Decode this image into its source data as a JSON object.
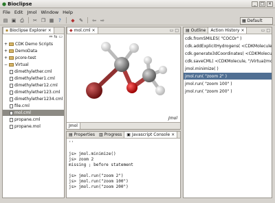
{
  "window": {
    "title": "Bioclipse"
  },
  "menu": [
    "File",
    "Edit",
    "Jmol",
    "Window",
    "Help"
  ],
  "perspective": {
    "label": "Default"
  },
  "explorer": {
    "tab_label": "Bioclipse Explorer",
    "items": [
      {
        "label": "CDK Demo Scripts",
        "kind": "folder",
        "indent": 0,
        "expander": "+"
      },
      {
        "label": "DemoData",
        "kind": "folder",
        "indent": 0,
        "expander": "+"
      },
      {
        "label": "pcore-test",
        "kind": "folder",
        "indent": 0,
        "expander": "+"
      },
      {
        "label": "Virtual",
        "kind": "folder",
        "indent": 0,
        "expander": "−"
      },
      {
        "label": "dimethylether.cml",
        "kind": "file",
        "indent": 1
      },
      {
        "label": "dimethylether1.cml",
        "kind": "file",
        "indent": 1
      },
      {
        "label": "dimethylether12.cml",
        "kind": "file",
        "indent": 1
      },
      {
        "label": "dimethylether123.cml",
        "kind": "file",
        "indent": 1
      },
      {
        "label": "dimethylether1234.cml",
        "kind": "file",
        "indent": 1
      },
      {
        "label": "file.cml",
        "kind": "file",
        "indent": 1
      },
      {
        "label": "mol.cml",
        "kind": "file",
        "indent": 1,
        "selected": true
      },
      {
        "label": "propane.cml",
        "kind": "file",
        "indent": 1
      },
      {
        "label": "propane.mol",
        "kind": "file",
        "indent": 1
      }
    ]
  },
  "editor": {
    "tab_label": "mol.cml",
    "watermark": "Jmol",
    "bottom_tab": "Jmol"
  },
  "outline": {
    "tabs": [
      "Outline",
      "Action History"
    ],
    "history": [
      "cdk.fromSMILES( \"COCOr\" )",
      "cdk.addExplicitHydrogens( <CDKMolecule )",
      "cdk.generate3dCoordinates( <CDKMolecule )",
      "cdk.saveCML( <CDKMolecule, \"/Virtual/mol.cml\" )",
      "jmol.minimize( )",
      "jmol.run( \"zoom 2\" )",
      "jmol.run( \"zoom 100\" )",
      "jmol.run( \"zoom 200\" )"
    ],
    "selected_index": 5
  },
  "console": {
    "tabs": [
      "Properties",
      "Progress",
      "Javascript Console"
    ],
    "lines": [
      "''",
      "",
      "js> jmol.minimize()",
      "js> zoom 2",
      "missing ; before statement",
      "",
      "js> jmol.run(\"zoom 2\")",
      "js> jmol.run(\"zoom 100\")",
      "js> jmol.run(\"zoom 200\")"
    ]
  }
}
